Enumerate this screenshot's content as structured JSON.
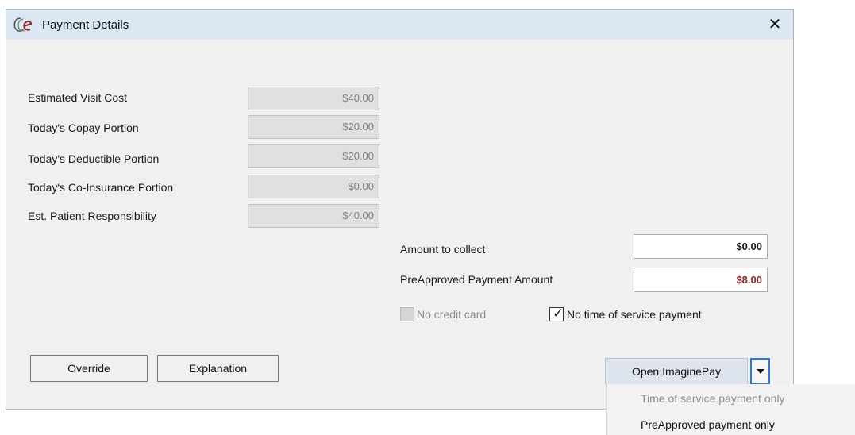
{
  "window": {
    "title": "Payment Details",
    "close_glyph": "✕",
    "logo_text": "ℓe"
  },
  "estimates": [
    {
      "label": "Estimated Visit Cost",
      "value": "$40.00"
    },
    {
      "label": "Today's Copay Portion",
      "value": "$20.00"
    },
    {
      "label": "Today's Deductible Portion",
      "value": "$20.00"
    },
    {
      "label": "Today's Co-Insurance Portion",
      "value": "$0.00"
    },
    {
      "label": "Est. Patient Responsibility",
      "value": "$40.00"
    }
  ],
  "collect": {
    "amount_label": "Amount to collect",
    "amount_value": "$0.00",
    "preapproved_label": "PreApproved Payment Amount",
    "preapproved_value": "$8.00",
    "preapproved_color": "#8b2a2a"
  },
  "options": {
    "no_credit_card_label": "No credit card",
    "no_credit_card_checked": false,
    "no_credit_card_disabled": true,
    "no_time_of_service_label": "No time of service payment",
    "no_time_of_service_checked": true
  },
  "buttons": {
    "override": "Override",
    "explanation": "Explanation",
    "open_imaginepay": "Open ImaginePay"
  },
  "dropdown": {
    "items": [
      {
        "label": "Time of service payment only",
        "disabled": true
      },
      {
        "label": "PreApproved payment only",
        "disabled": false
      }
    ]
  },
  "colors": {
    "titlebar": "#dbe7f3",
    "dialog_bg": "#f0f0f0",
    "focus_border": "#2d7ad6",
    "logo": "#8b2a2a"
  }
}
